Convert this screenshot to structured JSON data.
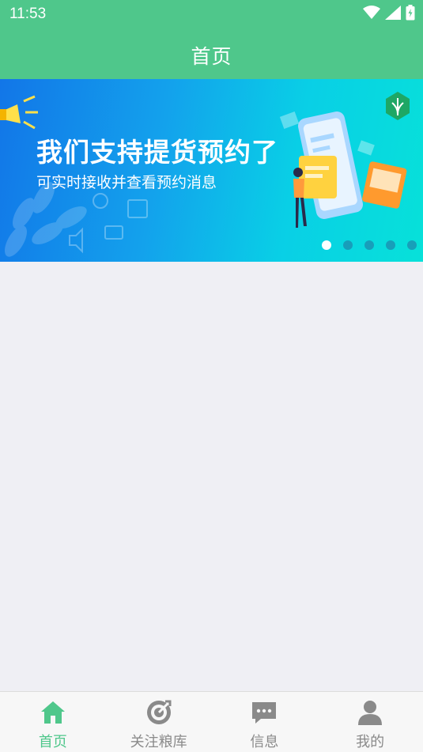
{
  "status_bar": {
    "time": "11:53"
  },
  "header": {
    "title": "首页"
  },
  "banner": {
    "title": "我们支持提货预约了",
    "subtitle": "可实时接收并查看预约消息",
    "dots_count": 5,
    "active_index": 0
  },
  "tabs": [
    {
      "label": "首页",
      "icon": "home-icon",
      "active": true
    },
    {
      "label": "关注粮库",
      "icon": "target-icon",
      "active": false
    },
    {
      "label": "信息",
      "icon": "message-icon",
      "active": false
    },
    {
      "label": "我的",
      "icon": "user-icon",
      "active": false
    }
  ],
  "colors": {
    "primary": "#4fc78b",
    "inactive": "#8a8a8a",
    "background": "#efeff4"
  }
}
